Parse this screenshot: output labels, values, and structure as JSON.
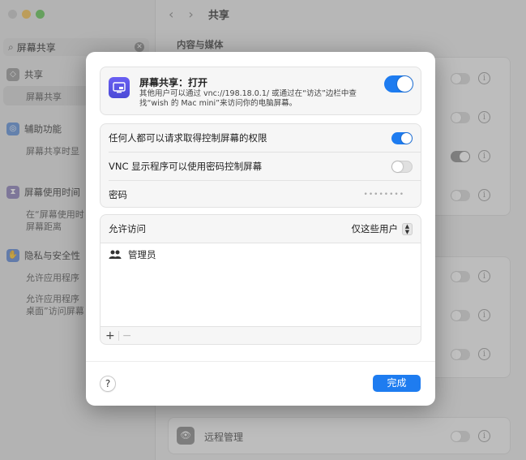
{
  "sidebar": {
    "search_value": "屏幕共享",
    "items": [
      {
        "label": "共享",
        "subs": [
          "屏幕共享"
        ]
      },
      {
        "label": "辅助功能",
        "subs": [
          "屏幕共享时显"
        ]
      },
      {
        "label": "屏幕使用时间",
        "subs": [
          "在“屏幕使用时",
          "屏幕距离"
        ]
      },
      {
        "label": "隐私与安全性",
        "subs": [
          "允许应用程序",
          "允许应用程序",
          "桌面”访问屏幕"
        ]
      }
    ]
  },
  "main": {
    "title": "共享",
    "section_label": "内容与媒体",
    "remote_label": "远程管理"
  },
  "dialog": {
    "header": {
      "title": "屏幕共享：打开",
      "description": "其他用户可以通过 vnc://198.18.0.1/ 或通过在“访达”边栏中查找“wish 的 Mac mini”来访问你的电脑屏幕。",
      "enabled": true
    },
    "options": [
      {
        "label": "任何人都可以请求取得控制屏幕的权限",
        "enabled": true
      },
      {
        "label": "VNC 显示程序可以使用密码控制屏幕",
        "enabled": false
      }
    ],
    "password": {
      "label": "密码",
      "value": "••••••••"
    },
    "access": {
      "label": "允许访问",
      "value": "仅这些用户",
      "users": [
        "管理员"
      ],
      "add_label": "+",
      "remove_label": "−"
    },
    "help_label": "?",
    "done_label": "完成"
  },
  "colors": {
    "accent": "#1e7cf0",
    "app_icon": "#5b52e8"
  }
}
